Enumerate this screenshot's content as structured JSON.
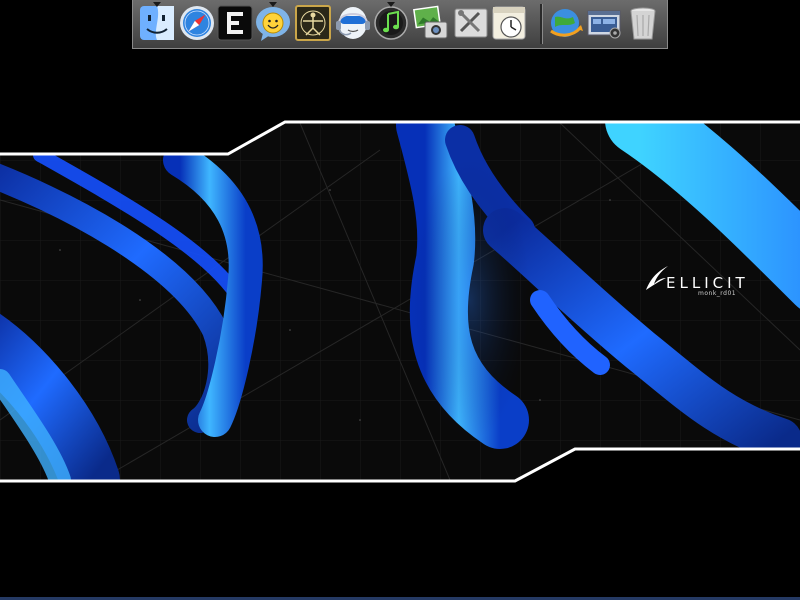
{
  "desktop": {
    "background_color": "#000000",
    "accent_color": "#1e7bff",
    "frame_color": "#ffffff"
  },
  "dock": {
    "items": [
      {
        "id": "finder",
        "icon": "finder-icon",
        "running": true
      },
      {
        "id": "safari",
        "icon": "safari-compass-icon",
        "running": false
      },
      {
        "id": "e-app",
        "icon": "e-letter-icon",
        "running": false
      },
      {
        "id": "messenger",
        "icon": "smiley-chat-icon",
        "running": true
      },
      {
        "id": "virtual-pc",
        "icon": "vitruvian-man-icon",
        "running": false
      },
      {
        "id": "headset",
        "icon": "headset-face-icon",
        "running": false
      },
      {
        "id": "itunes",
        "icon": "music-note-icon",
        "running": true
      },
      {
        "id": "iphoto",
        "icon": "photo-camera-icon",
        "running": false
      },
      {
        "id": "utilities",
        "icon": "utilities-tools-icon",
        "running": false
      },
      {
        "id": "time-machine",
        "icon": "clock-icon",
        "running": false
      },
      {
        "id": "network",
        "icon": "globe-sync-icon",
        "running": false
      },
      {
        "id": "window-manager",
        "icon": "window-gear-icon",
        "running": false
      },
      {
        "id": "trash",
        "icon": "trash-icon",
        "running": false
      }
    ]
  },
  "wallpaper": {
    "brand_name": "ELLICIT",
    "brand_sub": "monk_rd01"
  }
}
